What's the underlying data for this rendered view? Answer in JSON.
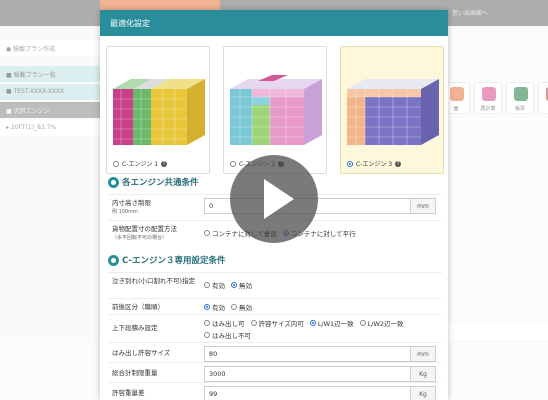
{
  "background": {
    "topbar_right_label": "思い出画面へ",
    "sidebar": [
      {
        "label": "● 積載プラン作成"
      },
      {
        "label": "■ 積載プラン一覧"
      },
      {
        "label": "■ TEST-XXXX-XXXX"
      },
      {
        "label": "■ 汎用エンジン"
      },
      {
        "label": "▸ 20FT(1)_83.7%"
      }
    ],
    "tools": [
      {
        "label": "面",
        "icon": "orange-icon"
      },
      {
        "label": "再計算",
        "icon": "recalc-icon"
      },
      {
        "label": "帳票",
        "icon": "excel-icon"
      },
      {
        "label": "",
        "icon": "document-icon"
      }
    ]
  },
  "modal": {
    "title": "最適化設定",
    "engines": [
      {
        "label": "C-エンジン 1",
        "selected": false
      },
      {
        "label": "C-エンジン 2",
        "selected": false
      },
      {
        "label": "C-エンジン 3",
        "selected": true
      }
    ],
    "common_section_title": "各エンジン共通条件",
    "height_limit": {
      "label": "内寸高さ制限",
      "sub": "例 100mm",
      "value": "0",
      "unit": "mm"
    },
    "orientation": {
      "label": "貨物配置寸の配置方法",
      "sub": "（水平回転不可の場合）",
      "options": [
        {
          "label": "コンテナに対して垂直",
          "selected": false
        },
        {
          "label": "コンテナに対して平行",
          "selected": true
        }
      ]
    },
    "engine3_section_title": "C-エンジン３専用設定条件",
    "split": {
      "label": "泣き別れ(小口割れ不可)指定",
      "options": [
        {
          "label": "有効",
          "selected": false
        },
        {
          "label": "無効",
          "selected": true
        }
      ]
    },
    "front_back": {
      "label": "前後区分（職順）",
      "options": [
        {
          "label": "有効",
          "selected": true
        },
        {
          "label": "無効",
          "selected": false
        }
      ]
    },
    "stacking": {
      "label": "上下段積み設定",
      "options": [
        {
          "label": "はみ出し可",
          "selected": false
        },
        {
          "label": "許容サイズ内可",
          "selected": false
        },
        {
          "label": "L/W1辺一致",
          "selected": true
        },
        {
          "label": "L/W2辺一致",
          "selected": false
        },
        {
          "label": "はみ出し不可",
          "selected": false
        }
      ]
    },
    "overhang": {
      "label": "はみ出し許容サイズ",
      "value": "80",
      "unit": "mm"
    },
    "total_weight": {
      "label": "総合計制限重量",
      "value": "3000",
      "unit": "Kg"
    },
    "allow_weight": {
      "label": "許容重量差",
      "value": "99",
      "unit": "Kg"
    }
  },
  "colors": {
    "header": "#2a8e9a",
    "selected_card": "#fdf8dc",
    "radio_on": "#2b6fd6"
  }
}
